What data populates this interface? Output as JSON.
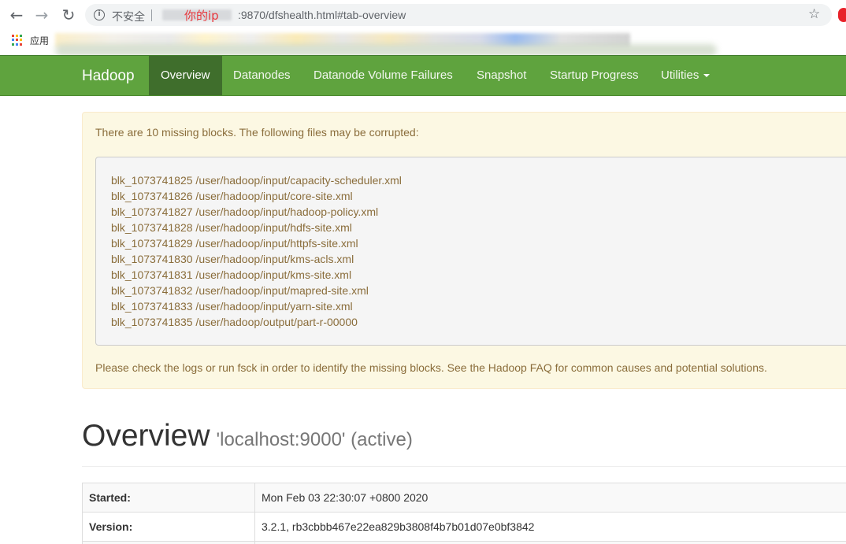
{
  "browser": {
    "security_label": "不安全",
    "url_annotation": "你的ip",
    "url_suffix": ":9870/dfshealth.html#tab-overview",
    "bookmarks_label": "应用",
    "apps_colors": [
      "#ea4335",
      "#fbbc05",
      "#34a853",
      "#4285f4",
      "#ea4335",
      "#fbbc05",
      "#34a853",
      "#4285f4",
      "#ea4335"
    ]
  },
  "navbar": {
    "brand": "Hadoop",
    "items": [
      {
        "label": "Overview",
        "active": true
      },
      {
        "label": "Datanodes"
      },
      {
        "label": "Datanode Volume Failures"
      },
      {
        "label": "Snapshot"
      },
      {
        "label": "Startup Progress"
      },
      {
        "label": "Utilities"
      }
    ],
    "color": "#5fa33e"
  },
  "alert": {
    "heading": "There are 10 missing blocks. The following files may be corrupted:",
    "blocks": [
      "blk_1073741825 /user/hadoop/input/capacity-scheduler.xml",
      "blk_1073741826 /user/hadoop/input/core-site.xml",
      "blk_1073741827 /user/hadoop/input/hadoop-policy.xml",
      "blk_1073741828 /user/hadoop/input/hdfs-site.xml",
      "blk_1073741829 /user/hadoop/input/httpfs-site.xml",
      "blk_1073741830 /user/hadoop/input/kms-acls.xml",
      "blk_1073741831 /user/hadoop/input/kms-site.xml",
      "blk_1073741832 /user/hadoop/input/mapred-site.xml",
      "blk_1073741833 /user/hadoop/input/yarn-site.xml",
      "blk_1073741835 /user/hadoop/output/part-r-00000"
    ],
    "footer": "Please check the logs or run fsck in order to identify the missing blocks. See the Hadoop FAQ for common causes and potential solutions."
  },
  "overview": {
    "title": "Overview",
    "subtitle": "'localhost:9000' (active)",
    "rows": [
      {
        "key": "Started:",
        "value": "Mon Feb 03 22:30:07 +0800 2020"
      },
      {
        "key": "Version:",
        "value": "3.2.1, rb3cbbb467e22ea829b3808f4b7b01d07e0bf3842"
      }
    ]
  }
}
